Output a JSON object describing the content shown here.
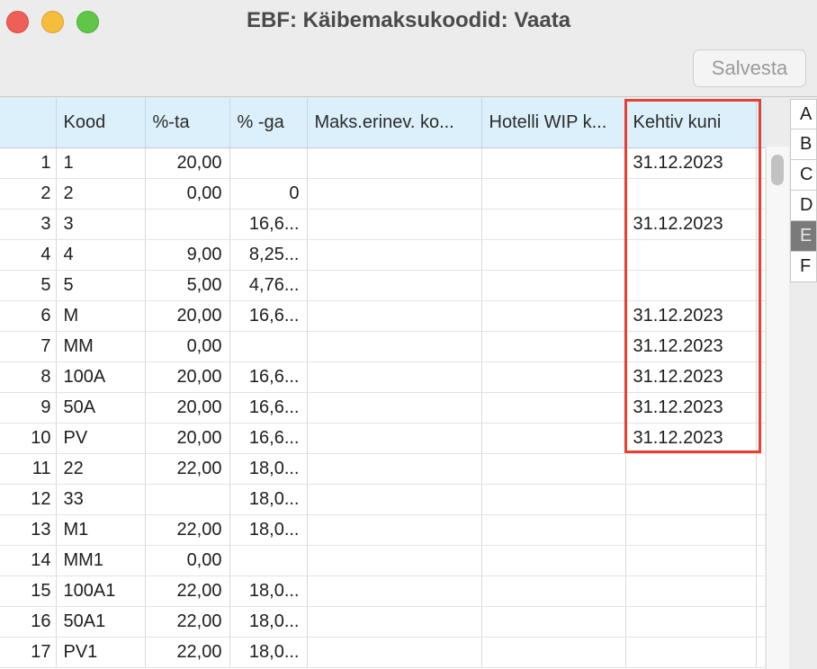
{
  "window": {
    "title": "EBF: Käibemaksukoodid: Vaata"
  },
  "toolbar": {
    "save_label": "Salvesta"
  },
  "columns": [
    "",
    "Kood",
    "%-ta",
    "% -ga",
    "Maks.erinev. ko...",
    "Hotelli WIP k...",
    "Kehtiv kuni"
  ],
  "rows": [
    [
      "1",
      "1",
      "20,00",
      "",
      "",
      "",
      "31.12.2023"
    ],
    [
      "2",
      "2",
      "0,00",
      "0",
      "",
      "",
      ""
    ],
    [
      "3",
      "3",
      "",
      "16,6...",
      "",
      "",
      "31.12.2023"
    ],
    [
      "4",
      "4",
      "9,00",
      "8,25...",
      "",
      "",
      ""
    ],
    [
      "5",
      "5",
      "5,00",
      "4,76...",
      "",
      "",
      ""
    ],
    [
      "6",
      "M",
      "20,00",
      "16,6...",
      "",
      "",
      "31.12.2023"
    ],
    [
      "7",
      "MM",
      "0,00",
      "",
      "",
      "",
      "31.12.2023"
    ],
    [
      "8",
      "100A",
      "20,00",
      "16,6...",
      "",
      "",
      "31.12.2023"
    ],
    [
      "9",
      "50A",
      "20,00",
      "16,6...",
      "",
      "",
      "31.12.2023"
    ],
    [
      "10",
      "PV",
      "20,00",
      "16,6...",
      "",
      "",
      "31.12.2023"
    ],
    [
      "11",
      "22",
      "22,00",
      "18,0...",
      "",
      "",
      ""
    ],
    [
      "12",
      "33",
      "",
      "18,0...",
      "",
      "",
      ""
    ],
    [
      "13",
      "M1",
      "22,00",
      "18,0...",
      "",
      "",
      ""
    ],
    [
      "14",
      "MM1",
      "0,00",
      "",
      "",
      "",
      ""
    ],
    [
      "15",
      "100A1",
      "22,00",
      "18,0...",
      "",
      "",
      ""
    ],
    [
      "16",
      "50A1",
      "22,00",
      "18,0...",
      "",
      "",
      ""
    ],
    [
      "17",
      "PV1",
      "22,00",
      "18,0...",
      "",
      "",
      ""
    ]
  ],
  "side_letters": [
    "A",
    "B",
    "C",
    "D",
    "E",
    "F"
  ],
  "active_letter": "E",
  "colors": {
    "header_bg": "#dcf0fb",
    "highlight": "#e8402f"
  }
}
